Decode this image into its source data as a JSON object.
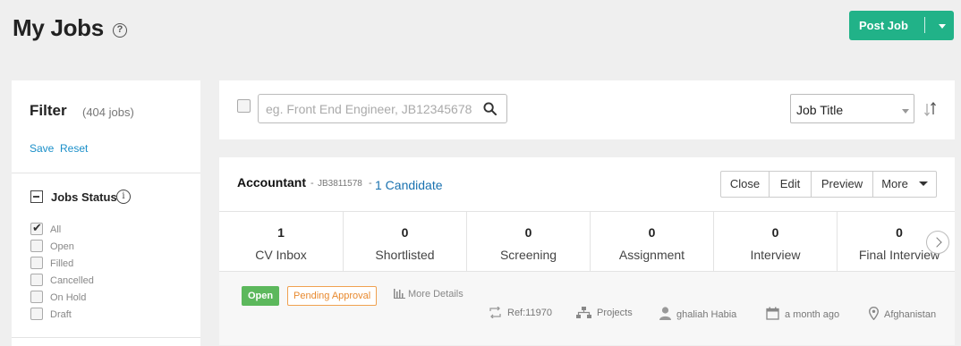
{
  "header": {
    "title": "My Jobs",
    "help_icon": "?",
    "post_job_label": "Post Job"
  },
  "filter": {
    "title": "Filter",
    "count": "(404 jobs)",
    "save": "Save",
    "reset": "Reset",
    "status_title": "Jobs Status",
    "info_icon": "i",
    "statuses": [
      {
        "label": "All",
        "checked": true
      },
      {
        "label": "Open",
        "checked": false
      },
      {
        "label": "Filled",
        "checked": false
      },
      {
        "label": "Cancelled",
        "checked": false
      },
      {
        "label": "On Hold",
        "checked": false
      },
      {
        "label": "Draft",
        "checked": false
      }
    ]
  },
  "search": {
    "placeholder": "eg. Front End Engineer, JB12345678",
    "sort_by": "Job Title"
  },
  "job": {
    "title": "Accountant",
    "dash": "-",
    "code": "JB3811578",
    "candidates": "1 Candidate",
    "actions": [
      "Close",
      "Edit",
      "Preview",
      "More"
    ],
    "stats": [
      {
        "num": "1",
        "label": "CV Inbox"
      },
      {
        "num": "0",
        "label": "Shortlisted"
      },
      {
        "num": "0",
        "label": "Screening"
      },
      {
        "num": "0",
        "label": "Assignment"
      },
      {
        "num": "0",
        "label": "Interview"
      },
      {
        "num": "0",
        "label": "Final Interview"
      }
    ],
    "status_badge": "Open",
    "approval_badge": "Pending Approval",
    "more_details": "More Details",
    "ref": "Ref:11970",
    "department": "Projects",
    "owner": "ghaliah Habia",
    "posted": "a month ago",
    "location": "Afghanistan"
  },
  "colors": {
    "primary": "#21b288",
    "link": "#1a8fc9",
    "open_badge": "#5cb85c",
    "pending_badge": "#e8892e"
  }
}
